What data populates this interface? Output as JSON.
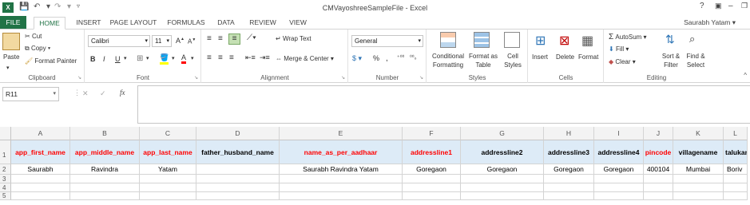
{
  "window": {
    "title": "CMVayoshreeSampleFile - Excel",
    "user": "Saurabh Yatam",
    "help": "?"
  },
  "tabs": [
    "FILE",
    "HOME",
    "INSERT",
    "PAGE LAYOUT",
    "FORMULAS",
    "DATA",
    "REVIEW",
    "VIEW"
  ],
  "ribbon": {
    "clipboard": {
      "paste": "Paste",
      "cut": "Cut",
      "copy": "Copy",
      "format_painter": "Format Painter",
      "label": "Clipboard"
    },
    "font": {
      "name": "Calibri",
      "size": "11",
      "label": "Font",
      "bold": "B",
      "italic": "I",
      "underline": "U",
      "grow": "A",
      "shrink": "A",
      "fontcolor": "A"
    },
    "alignment": {
      "wrap": "Wrap Text",
      "merge": "Merge & Center",
      "label": "Alignment"
    },
    "number": {
      "format": "General",
      "label": "Number",
      "currency": "$",
      "percent": "%",
      "comma": ","
    },
    "styles": {
      "conditional": "Conditional Formatting",
      "format_as_table": "Format as Table",
      "cell_styles": "Cell Styles",
      "label": "Styles"
    },
    "cells": {
      "insert": "Insert",
      "delete": "Delete",
      "format": "Format",
      "label": "Cells"
    },
    "editing": {
      "autosum": "AutoSum",
      "fill": "Fill",
      "clear": "Clear",
      "sort": "Sort & Filter",
      "find": "Find & Select",
      "label": "Editing"
    }
  },
  "formula_bar": {
    "name_box": "R11",
    "fx": "fx",
    "cancel": "✕",
    "enter": "✓",
    "value": ""
  },
  "sheet": {
    "columns": [
      "A",
      "B",
      "C",
      "D",
      "E",
      "F",
      "G",
      "H",
      "I",
      "J",
      "K",
      "L"
    ],
    "rows": [
      "1",
      "2",
      "3",
      "4",
      "5"
    ],
    "headers": [
      "app_first_name",
      "app_middle_name",
      "app_last_name",
      "father_husband_name",
      "name_as_per_aadhaar",
      "addressline1",
      "addressline2",
      "addressline3",
      "addressline4",
      "pincode",
      "villagename",
      "talukan"
    ],
    "header_red": [
      true,
      true,
      true,
      false,
      true,
      true,
      false,
      false,
      false,
      true,
      false,
      false
    ],
    "row2": [
      "Saurabh",
      "Ravindra",
      "Yatam",
      "",
      "Saurabh Ravindra Yatam",
      "Goregaon",
      "Goregaon",
      "Goregaon",
      "Goregaon",
      "400104",
      "Mumbai",
      "Boriv"
    ]
  },
  "colors": {
    "excel_green": "#217346",
    "header_fill": "#ddebf7",
    "required_red": "#ff0000"
  }
}
